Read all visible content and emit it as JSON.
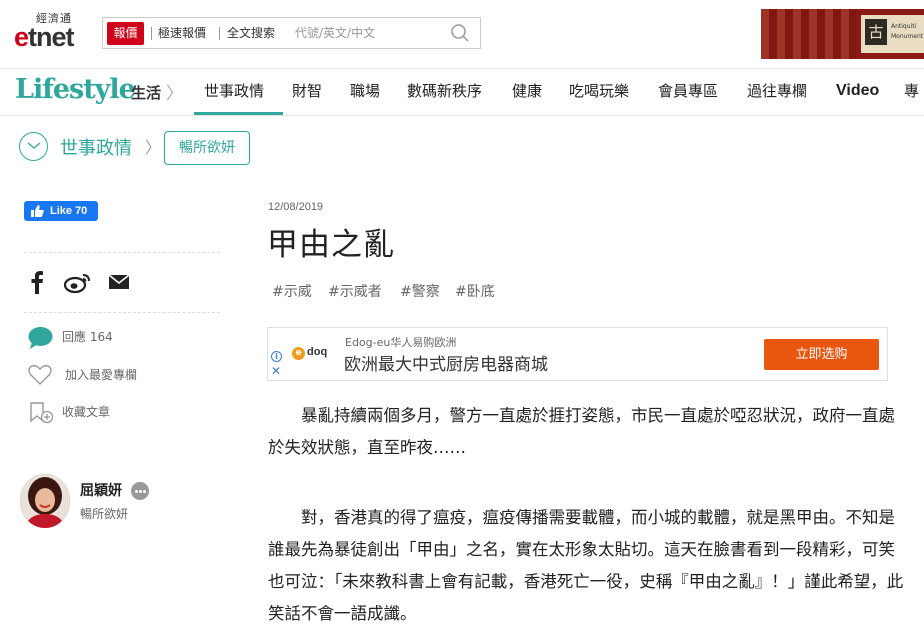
{
  "header": {
    "logo_small": "經濟通",
    "logo_main_prefix": "e",
    "logo_main_rest": "tnet",
    "search": {
      "tag": "報價",
      "option_1": "極速報價",
      "option_2": "全文搜索",
      "placeholder": "代號/英文/中文",
      "icon": "search-icon"
    },
    "ad_banner": {
      "seal": "古",
      "line_1": "Antiquiti",
      "line_2": "Monument"
    }
  },
  "nav": {
    "brand": "Lifestyle",
    "brand_sub": "生活",
    "chevron": "〉",
    "items": [
      "世事政情",
      "財智",
      "職場",
      "數碼新秩序",
      "健康",
      "吃喝玩樂",
      "會員專區",
      "過往專欄",
      "Video",
      "專"
    ],
    "active_index": 0,
    "accent": "#2fa79c"
  },
  "breadcrumb": {
    "icon": "chevron-down-icon",
    "section": "世事政情",
    "chevron": "〉",
    "column": "暢所欲妍"
  },
  "sidebar": {
    "like_label": "Like 70",
    "share_icons": [
      "facebook-icon",
      "weibo-icon",
      "email-icon"
    ],
    "comments_label": "回應",
    "comments_count": "164",
    "favorite_label": "加入最愛專欄",
    "bookmark_label": "收藏文章",
    "author": {
      "name": "屈穎妍",
      "column": "暢所欲妍"
    }
  },
  "article": {
    "date": "12/08/2019",
    "title": "甲由之亂",
    "tags": [
      "#示威",
      "#示威者",
      "#警察",
      "#卧底"
    ],
    "paragraphs": [
      "暴亂持續兩個多月，警方一直處於捱打姿態，市民一直處於啞忍狀況，政府一直處於失效狀態，直至昨夜……",
      "對，香港真的得了瘟疫，瘟疫傳播需要載體，而小城的載體，就是黑甲由。不知是誰最先為暴徒創出「甲由」之名，實在太形象太貼切。這天在臉書看到一段精彩，可笑也可泣：「未來教科書上會有記載，香港死亡一役，史稱『甲由之亂』！」謹此希望，此笑話不會一語成讖。"
    ]
  },
  "ad": {
    "logo_badge": "e",
    "logo_text": "doq",
    "advertiser": "Edog-eu华人易购欧洲",
    "headline": "欧洲最大中式厨房电器商城",
    "cta": "立即选购",
    "cta_color": "#e8560f"
  }
}
